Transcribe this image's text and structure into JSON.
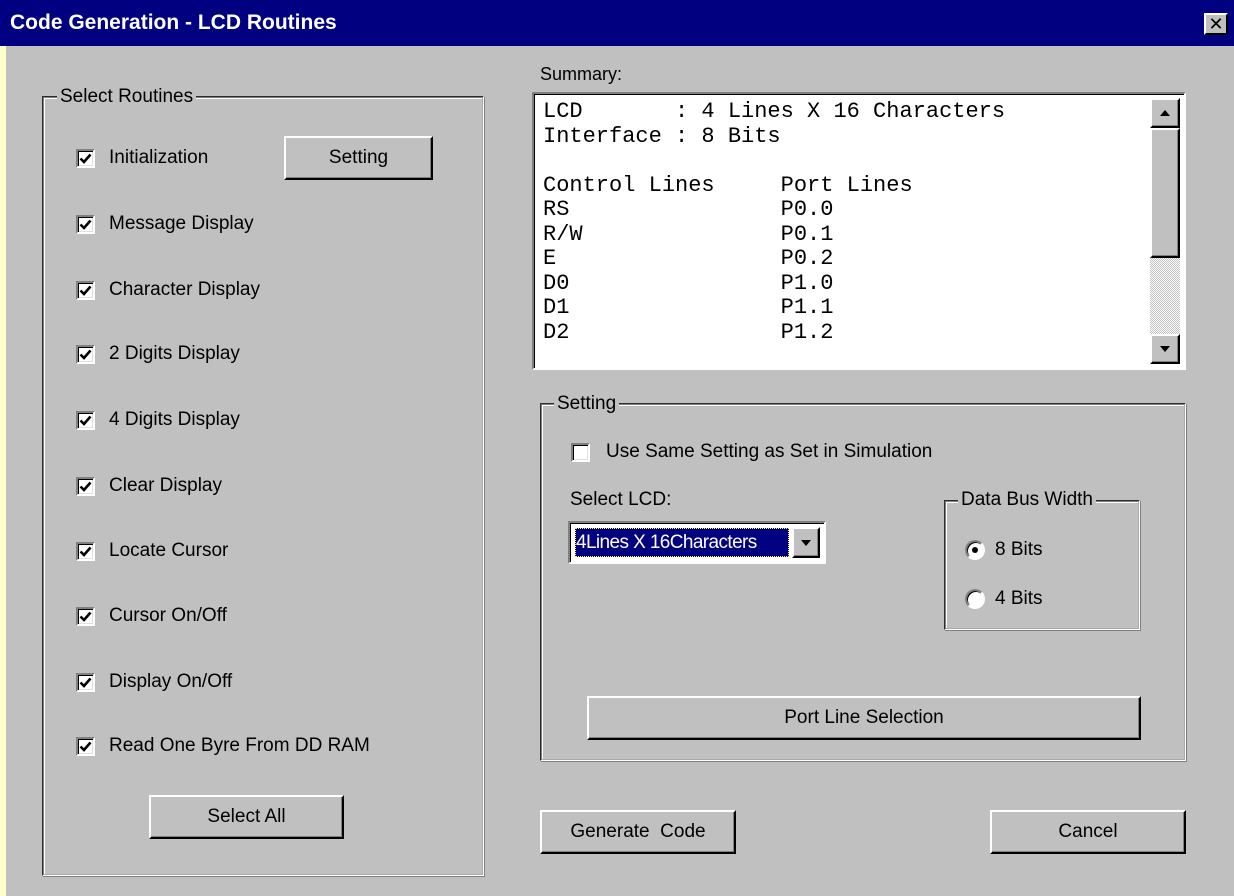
{
  "window": {
    "title": "Code Generation - LCD Routines",
    "close_glyph": "✕"
  },
  "routines": {
    "legend": "Select Routines",
    "items": [
      {
        "label": "Initialization",
        "checked": true
      },
      {
        "label": "Message Display",
        "checked": true
      },
      {
        "label": "Character Display",
        "checked": true
      },
      {
        "label": "2 Digits Display",
        "checked": true
      },
      {
        "label": "4 Digits Display",
        "checked": true
      },
      {
        "label": "Clear Display",
        "checked": true
      },
      {
        "label": "Locate Cursor",
        "checked": true
      },
      {
        "label": "Cursor On/Off",
        "checked": true
      },
      {
        "label": "Display On/Off",
        "checked": true
      },
      {
        "label": "Read One Byre From DD RAM",
        "checked": true
      }
    ],
    "setting_button": "Setting",
    "select_all_button": "Select All"
  },
  "summary": {
    "label": "Summary:",
    "lines": [
      "LCD       : 4 Lines X 16 Characters",
      "Interface : 8 Bits",
      "",
      "Control Lines     Port Lines",
      "RS                P0.0",
      "R/W               P0.1",
      "E                 P0.2",
      "D0                P1.0",
      "D1                P1.1",
      "D2                P1.2"
    ]
  },
  "setting": {
    "legend": "Setting",
    "use_same_label": "Use Same Setting as Set in Simulation",
    "use_same_checked": false,
    "select_lcd_label": "Select LCD:",
    "select_lcd_value": "4Lines X 16Characters",
    "bus_width": {
      "legend": "Data Bus Width",
      "options": [
        {
          "label": "8 Bits",
          "selected": true
        },
        {
          "label": "4 Bits",
          "selected": false
        }
      ]
    },
    "port_line_button": "Port Line Selection"
  },
  "footer": {
    "generate_button": "Generate  Code",
    "cancel_button": "Cancel"
  }
}
